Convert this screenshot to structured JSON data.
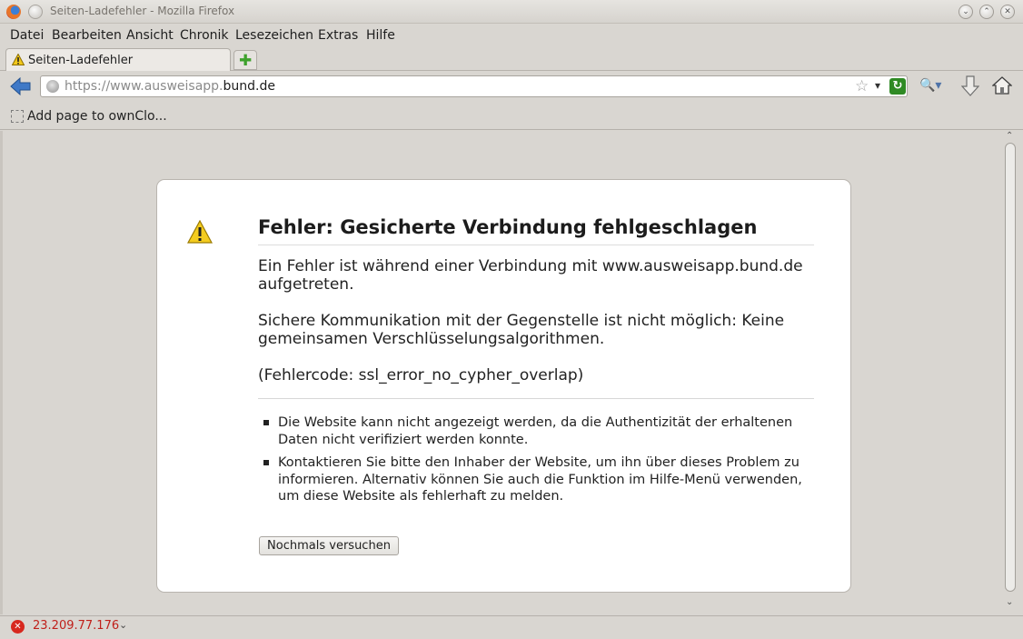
{
  "window": {
    "title": "Seiten-Ladefehler - Mozilla Firefox",
    "controls": {
      "minimize": "⌄",
      "maximize": "⌃",
      "close": "✕"
    }
  },
  "menu": [
    "Datei",
    "Bearbeiten",
    "Ansicht",
    "Chronik",
    "Lesezeichen",
    "Extras",
    "Hilfe"
  ],
  "tabs": [
    {
      "label": "Seiten-Ladefehler",
      "icon": "warning-icon"
    }
  ],
  "newtab": {
    "icon": "plus-icon"
  },
  "nav": {
    "url_prefix": "https://www.ausweisapp.",
    "url_domain": "bund.de",
    "star": "☆",
    "chevron": "▾",
    "reload": "↻"
  },
  "bookmarks": [
    {
      "label": "Add page to ownClo..."
    }
  ],
  "error": {
    "title": "Fehler: Gesicherte Verbindung fehlgeschlagen",
    "p1": "Ein Fehler ist während einer Verbindung mit www.ausweisapp.bund.de aufgetreten.",
    "p2": "Sichere Kommunikation mit der Gegenstelle ist nicht möglich: Keine gemeinsamen Verschlüsselungsalgorithmen.",
    "p3": "(Fehlercode: ssl_error_no_cypher_overlap)",
    "bullets": [
      "Die Website kann nicht angezeigt werden, da die Authentizität der erhaltenen Daten nicht verifiziert werden konnte.",
      "Kontaktieren Sie bitte den Inhaber der Website, um ihn über dieses Problem zu informieren. Alternativ können Sie auch die Funktion im Hilfe-Menü verwenden, um diese Website als fehlerhaft zu melden."
    ],
    "retry_label": "Nochmals versuchen"
  },
  "status": {
    "text": "23.209.77.176",
    "icon": "error-icon",
    "chevron": "⌄"
  },
  "colors": {
    "accent": "#2f8a24",
    "error": "#c0201a",
    "warning": "#f2c81a"
  }
}
